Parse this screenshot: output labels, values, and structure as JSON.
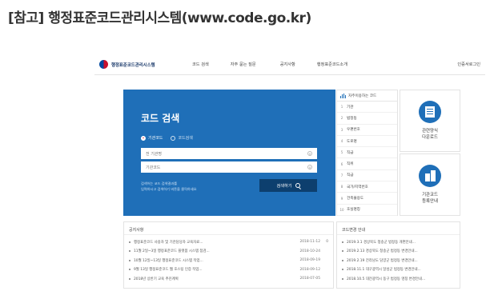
{
  "heading": "[참고] 행정표준코드관리시스템(www.code.go.kr)",
  "site": {
    "logo_text": "행정표준코드관리시스템",
    "nav": [
      "코드 검색",
      "자주 묻는 질문",
      "공지사항",
      "행정표준코드소개"
    ],
    "header_right": "인증서로그인"
  },
  "search": {
    "title": "코드 검색",
    "radio_selected": "기관코드",
    "radio_other": "코드검색",
    "field1_placeholder": "전 기관명",
    "field2_placeholder": "기관코드",
    "hint_line1": "검색어는 코드 검색결과를",
    "hint_line2": "입력하시고 검색하기 버튼을 클릭하세요",
    "button_label": "검색하기"
  },
  "popular": {
    "title": "자주이용하는 코드",
    "items": [
      {
        "num": "1",
        "label": "기관"
      },
      {
        "num": "2",
        "label": "법정동"
      },
      {
        "num": "3",
        "label": "우편번호"
      },
      {
        "num": "4",
        "label": "도로명"
      },
      {
        "num": "5",
        "label": "직급"
      },
      {
        "num": "6",
        "label": "직위"
      },
      {
        "num": "7",
        "label": "직급"
      },
      {
        "num": "8",
        "label": "국가/지역번호"
      },
      {
        "num": "9",
        "label": "건축물용도"
      },
      {
        "num": "10",
        "label": "호실명칭"
      }
    ]
  },
  "quick": [
    {
      "label": "관련양식\n다운로드",
      "icon": "document-icon"
    },
    {
      "label": "기관코드\n등록안내",
      "icon": "building-icon"
    }
  ],
  "notices": {
    "title": "공지사항",
    "items": [
      {
        "text": "행정표준코드 사용자 및 기관담당자 교육자료...",
        "date": "2018-11-12",
        "count": "0"
      },
      {
        "text": "11월 2일~3일 행정표준코드 플랫폼 시스템 점검...",
        "date": "2018-10-24",
        "count": ""
      },
      {
        "text": "10월 12일~13일 행정표준코드 시스템 작업...",
        "date": "2018-09-19",
        "count": ""
      },
      {
        "text": "9월 13일 행정표준코드 웹 호스팅 인증 작업...",
        "date": "2018-09-12",
        "count": ""
      },
      {
        "text": "2018년 상반기 교육 추진계획",
        "date": "2018-07-05",
        "count": ""
      }
    ]
  },
  "changes": {
    "title": "코드변경 안내",
    "items": [
      {
        "text": "2019.3.1 경상북도 청송군 법정동 개편안내..."
      },
      {
        "text": "2019.2.13 경상북도 청송군 법정동 변경안내..."
      },
      {
        "text": "2019.2.19 전라남도 담양군 법정동 변경안내..."
      },
      {
        "text": "2018.11.1 대구광역시 달성군 법정동 변경안내..."
      },
      {
        "text": "2018.10.5 대전광역시 동구 법정동 명칭 변경안내..."
      }
    ]
  }
}
